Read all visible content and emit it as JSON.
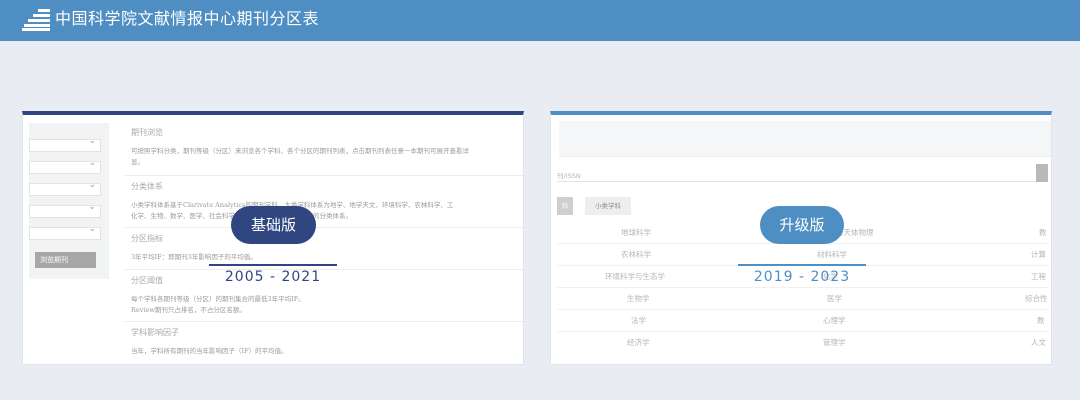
{
  "header": {
    "title": "中国科学院文献情报中心期刊分区表",
    "logo_icon": "stairs-logo-icon",
    "background": "#4f8ec3"
  },
  "basic": {
    "badge": "基础版",
    "years": "2005 - 2021",
    "accent": "#2f4680",
    "browse_button": "浏览期刊",
    "sections": [
      {
        "heading": "期刊浏览",
        "text": "可按照学科分类，期刊等级（分区）来浏览各个学科、各个分区的期刊列表，点击期刊列表任意一本期刊可展开查看详",
        "text2": "显。"
      },
      {
        "heading": "分类体系",
        "text": "小类学科体系基于Clarivate Analytics的期刊学科，大类学科体系为地学、地学天文、环境科学、农林科学、工",
        "text2": "化学、生物、数学、医学、社会科学等，并由期刊等学科所构成的分类体系。"
      },
      {
        "heading": "分区指标",
        "text": "3年平均IF：即期刊3年影响因子的平均值。",
        "text2": ""
      },
      {
        "heading": "分区阈值",
        "text": "每个学科各期刊等级（分区）的期刊集合的最低3年平均IF。",
        "text2": "Review期刊只占排名，不占分区名额。"
      },
      {
        "heading": "学科影响因子",
        "text": "当年，学科所有期刊的当年影响因子（IF）的平均值。",
        "text2": ""
      }
    ]
  },
  "upgrade": {
    "badge": "升级版",
    "years": "2019 - 2023",
    "accent": "#4f8ec3",
    "search_hint": "刊/ISSN",
    "tabs": [
      "科",
      "小类学科"
    ],
    "grid": [
      [
        "地球科学",
        "天文与天体物理",
        "数"
      ],
      [
        "农林科学",
        "材料科学",
        "计算"
      ],
      [
        "环境科学与生态学",
        "化学",
        "工程"
      ],
      [
        "生物学",
        "医学",
        "综合性"
      ],
      [
        "法学",
        "心理学",
        "数"
      ],
      [
        "经济学",
        "管理学",
        "人文"
      ]
    ]
  }
}
